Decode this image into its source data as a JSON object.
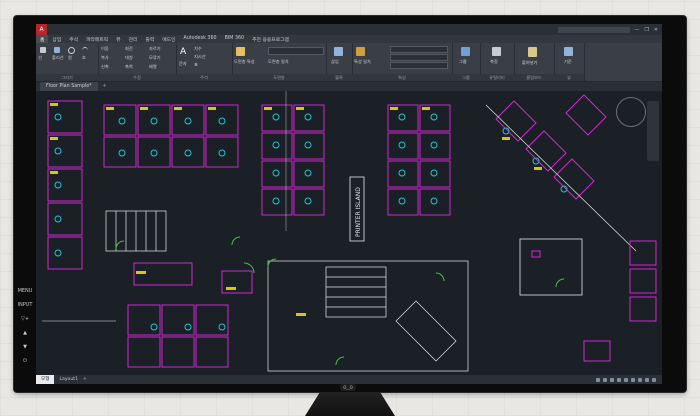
{
  "window": {
    "app_badge": "A",
    "title_text": "",
    "search_placeholder": "",
    "controls": [
      "—",
      "❐",
      "✕"
    ]
  },
  "ribbon_tabs": [
    "홈",
    "삽입",
    "주석",
    "파라메트릭",
    "뷰",
    "관리",
    "출력",
    "애드인",
    "Autodesk 360",
    "BIM 360",
    "추천 응용프로그램"
  ],
  "panels": [
    {
      "label": "그리기"
    },
    {
      "label": "수정"
    },
    {
      "label": "주석"
    },
    {
      "label": "도면층"
    },
    {
      "label": "블록"
    },
    {
      "label": "특성"
    },
    {
      "label": "그룹"
    },
    {
      "label": "유틸리티"
    },
    {
      "label": "클립보드"
    },
    {
      "label": "뷰"
    }
  ],
  "ribbon_tools": {
    "draw": [
      "선",
      "폴리선",
      "원",
      "호"
    ],
    "modify": [
      "이동",
      "회전",
      "자르기",
      "복사",
      "대칭",
      "모깎기",
      "신축",
      "축척",
      "배열"
    ],
    "annotation": [
      "문자",
      "치수",
      "지시선",
      "표"
    ],
    "layers": [
      "도면층 특성",
      "도면층 일치"
    ],
    "block": [
      "삽입"
    ],
    "properties": [
      "특성 일치"
    ],
    "group": [
      "그룹"
    ],
    "utilities": [
      "측정"
    ],
    "clipboard": [
      "붙여넣기"
    ],
    "view": [
      "기준"
    ]
  },
  "file_tabs": [
    {
      "label": "Floor Plan Sample*"
    }
  ],
  "drawing": {
    "printer_label": "PRINTER ISLAND"
  },
  "status_tabs": [
    "모형",
    "Layout1"
  ],
  "monitor": {
    "osd": [
      "MENU",
      "INPUT",
      "▽+",
      "▲",
      "▼",
      "⏻"
    ],
    "brand": "ʘ‿ʘ"
  },
  "colors": {
    "background": "#1b1f26",
    "magenta": "#d02ad0",
    "cyan": "#22c6d6",
    "yellow": "#d6c420",
    "white": "#e8e8e8",
    "green": "#3ec43e",
    "orange": "#e46a1a"
  }
}
